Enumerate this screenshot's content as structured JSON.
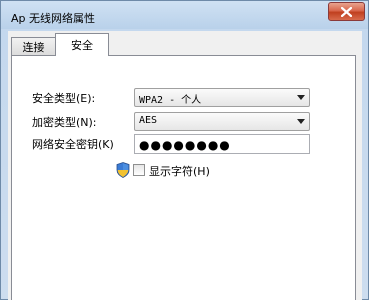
{
  "window": {
    "title": "Ap 无线网络属性"
  },
  "tabs": [
    {
      "label": "连接"
    },
    {
      "label": "安全"
    }
  ],
  "security": {
    "security_type_label": "安全类型(E):",
    "security_type_value": "WPA2 - 个人",
    "encryption_type_label": "加密类型(N):",
    "encryption_type_value": "AES",
    "network_key_label": "网络安全密钥(K)",
    "network_key_masked": "●●●●●●●●",
    "show_chars_label": "显示字符(H)",
    "show_chars_checked": false
  },
  "icons": {
    "close": "close-icon",
    "shield": "shield-icon",
    "dropdown": "chevron-down-icon"
  },
  "colors": {
    "title_gradient_top": "#cfe1f3",
    "close_button": "#c0401f",
    "panel_background": "#ffffff",
    "dialog_background": "#f0f0f0"
  }
}
